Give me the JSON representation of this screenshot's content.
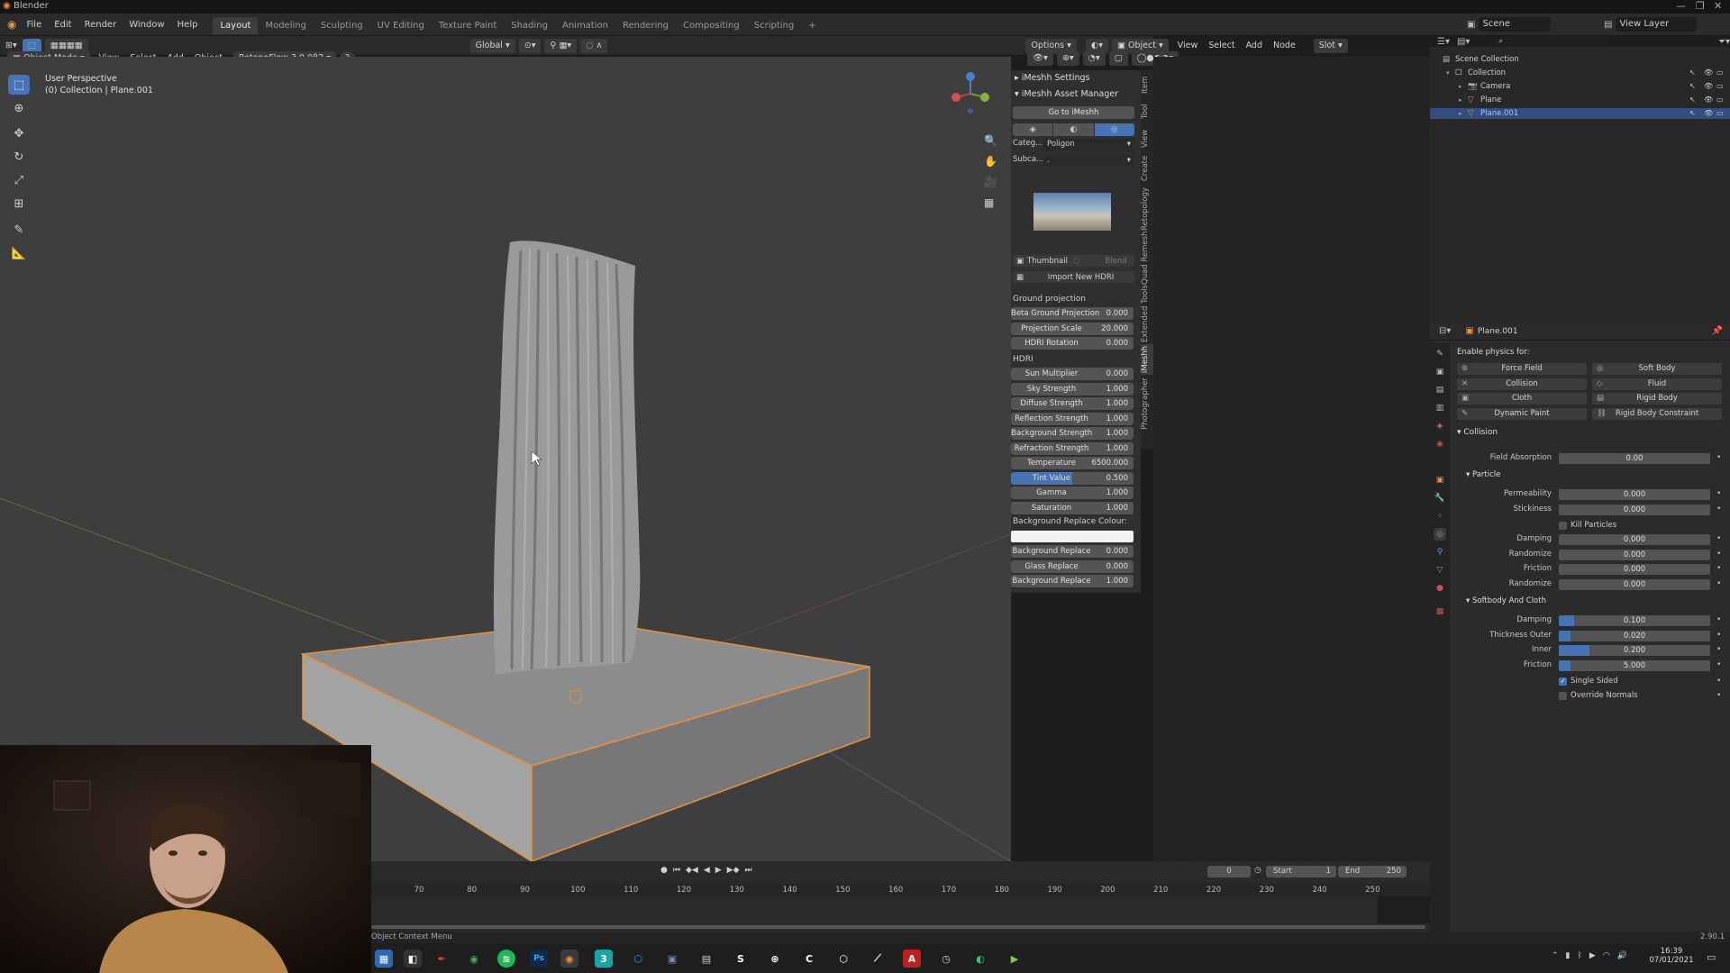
{
  "window": {
    "title": "Blender",
    "version": "2.90.1"
  },
  "menu": [
    "File",
    "Edit",
    "Render",
    "Window",
    "Help"
  ],
  "workspaces": [
    "Layout",
    "Modeling",
    "Sculpting",
    "UV Editing",
    "Texture Paint",
    "Shading",
    "Animation",
    "Rendering",
    "Compositing",
    "Scripting"
  ],
  "active_workspace": "Layout",
  "scene": {
    "name": "Scene",
    "view_layer": "View Layer"
  },
  "viewport_header": {
    "mode": "Object Mode",
    "menus": [
      "View",
      "Select",
      "Add",
      "Object"
    ],
    "addon": "RetopoFlow 3.0.0β2",
    "transform": "Global",
    "options": "Options"
  },
  "viewport": {
    "perspective": "User Perspective",
    "collection_info": "(0) Collection | Plane.001"
  },
  "node_header": {
    "type": "Object",
    "menus": [
      "View",
      "Select",
      "Add",
      "Node"
    ],
    "slot": "Slot"
  },
  "npanel": {
    "tabs": [
      "Item",
      "Tool",
      "View",
      "Create",
      "Retopology",
      "Quad Remesh",
      "Extended Tools",
      "iMeshh",
      "Photographer"
    ],
    "active_tab": "iMeshh",
    "settings_title": "iMeshh Settings",
    "asset_manager_title": "iMeshh Asset Manager",
    "goto_button": "Go to iMeshh",
    "category_label": "Categ...",
    "category_value": "Poligon",
    "subcategory_label": "Subca...",
    "subcategory_value": ".",
    "thumbnail_label": "Thumbnail",
    "blend_label": "Blend",
    "import_button": "Import New HDRI",
    "ground_section": "Ground projection",
    "ground_rows": [
      {
        "label": "Beta Ground Projection",
        "value": "0.000"
      },
      {
        "label": "Projection Scale",
        "value": "20.000"
      },
      {
        "label": "HDRI Rotation",
        "value": "0.000"
      }
    ],
    "hdri_section": "HDRI",
    "hdri_rows": [
      {
        "label": "Sun Multiplier",
        "value": "0.000",
        "fill": 0
      },
      {
        "label": "Sky Strength",
        "value": "1.000",
        "fill": 0
      },
      {
        "label": "Diffuse Strength",
        "value": "1.000",
        "fill": 0
      },
      {
        "label": "Reflection Strength",
        "value": "1.000",
        "fill": 0
      },
      {
        "label": "Background Strength",
        "value": "1.000",
        "fill": 0
      },
      {
        "label": "Refraction Strength",
        "value": "1.000",
        "fill": 0
      },
      {
        "label": "Temperature",
        "value": "6500.000",
        "fill": 0
      },
      {
        "label": "Tint Value",
        "value": "0.500",
        "fill": 0.5
      },
      {
        "label": "Gamma",
        "value": "1.000",
        "fill": 0
      },
      {
        "label": "Saturation",
        "value": "1.000",
        "fill": 0
      }
    ],
    "bg_colour_label": "Background Replace Colour:",
    "bg_rows": [
      {
        "label": "Background Replace",
        "value": "0.000"
      },
      {
        "label": "Glass Replace",
        "value": "0.000"
      },
      {
        "label": "Background Replace",
        "value": "1.000"
      }
    ]
  },
  "outliner": {
    "items": [
      {
        "name": "Scene Collection",
        "indent": 0
      },
      {
        "name": "Collection",
        "indent": 1
      },
      {
        "name": "Camera",
        "indent": 2
      },
      {
        "name": "Plane",
        "indent": 2
      },
      {
        "name": "Plane.001",
        "indent": 2,
        "selected": true
      }
    ]
  },
  "properties": {
    "object": "Plane.001",
    "enable_physics_label": "Enable physics for:",
    "physics_buttons": [
      "Force Field",
      "Soft Body",
      "Collision",
      "Fluid",
      "Cloth",
      "Rigid Body",
      "Dynamic Paint",
      "Rigid Body Constraint"
    ],
    "collision_section": "Collision",
    "field_absorption": {
      "label": "Field Absorption",
      "value": "0.00"
    },
    "particle_section": "Particle",
    "particle_rows": [
      {
        "label": "Permeability",
        "value": "0.000"
      },
      {
        "label": "Stickiness",
        "value": "0.000"
      }
    ],
    "kill_particles": "Kill Particles",
    "particle_rows2": [
      {
        "label": "Damping",
        "value": "0.000"
      },
      {
        "label": "Randomize",
        "value": "0.000"
      },
      {
        "label": "Friction",
        "value": "0.000"
      },
      {
        "label": "Randomize",
        "value": "0.000"
      }
    ],
    "softbody_section": "Softbody And Cloth",
    "softbody_rows": [
      {
        "label": "Damping",
        "value": "0.100",
        "fill": 0.1
      },
      {
        "label": "Thickness Outer",
        "value": "0.020",
        "fill": 0.02
      },
      {
        "label": "Inner",
        "value": "0.200",
        "fill": 0.2
      },
      {
        "label": "Friction",
        "value": "5.000",
        "fill": 0.05
      }
    ],
    "single_sided": "Single Sided",
    "override_normals": "Override Normals"
  },
  "timeline": {
    "current_frame": "0",
    "start_label": "Start",
    "start": "1",
    "end_label": "End",
    "end": "250",
    "ticks": [
      "70",
      "80",
      "90",
      "100",
      "110",
      "120",
      "130",
      "140",
      "150",
      "160",
      "170",
      "180",
      "190",
      "200",
      "210",
      "220",
      "230",
      "240",
      "250"
    ]
  },
  "status": {
    "context": "Object Context Menu"
  },
  "taskbar": {
    "time": "16:39",
    "date": "07/01/2021"
  },
  "colors": {
    "accent": "#4772b3",
    "selection": "#e8913a"
  }
}
